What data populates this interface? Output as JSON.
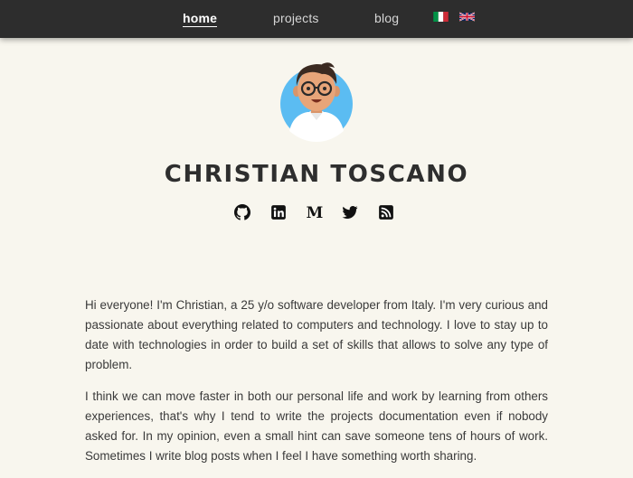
{
  "nav": {
    "items": [
      {
        "label": "home",
        "active": true
      },
      {
        "label": "projects",
        "active": false
      },
      {
        "label": "blog",
        "active": false
      }
    ],
    "languages": [
      "italian-flag-icon",
      "uk-flag-icon"
    ]
  },
  "profile": {
    "name": "CHRISTIAN TOSCANO",
    "avatar": "avatar-illustration"
  },
  "social_icons": [
    "github-icon",
    "linkedin-icon",
    "medium-icon",
    "twitter-icon",
    "rss-icon"
  ],
  "about": {
    "paragraphs": [
      "Hi everyone! I'm Christian, a 25 y/o software developer from Italy. I'm very curious and passionate about everything related to computers and technology. I love to stay up to date with technologies in order to build a set of skills that allows to solve any type of problem.",
      "I think we can move faster in both our personal life and work by learning from others experiences, that's why I tend to write the projects documentation even if nobody asked for. In my opinion, even a small hint can save someone tens of hours of work. Sometimes I write blog posts when I feel I have something worth sharing."
    ]
  },
  "colors": {
    "background": "#f8f6ee",
    "navbar": "#2d2d2d",
    "avatar_circle": "#5bbcf2",
    "text": "#3a3a3a"
  }
}
